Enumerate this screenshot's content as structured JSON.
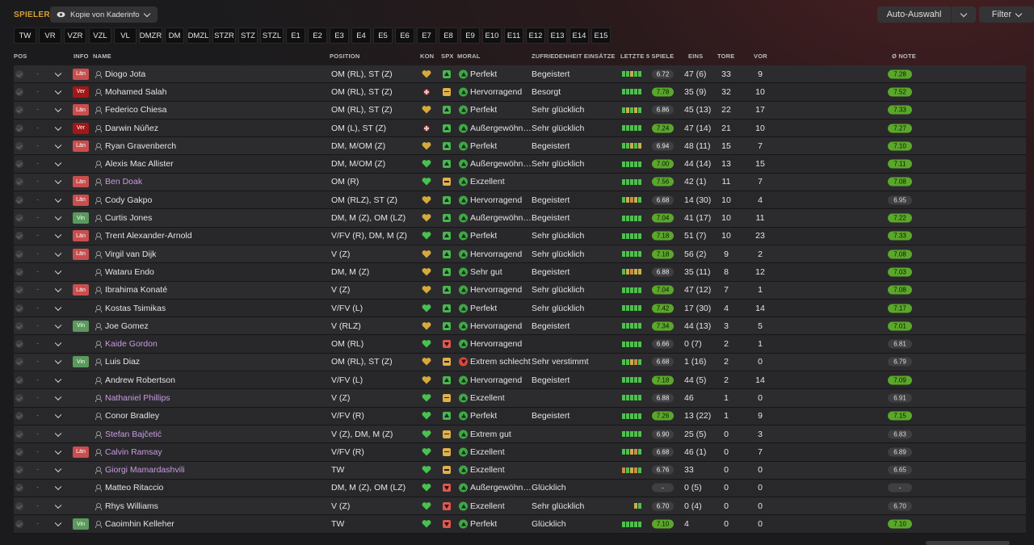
{
  "header": {
    "title": "SPIELER",
    "view": "Kopie von Kaderinfo",
    "auto_label": "Auto-Auswahl",
    "filter_label": "Filter"
  },
  "positions": [
    "TW",
    "VR",
    "VZR",
    "VZL",
    "VL",
    "DMZR",
    "DM",
    "DMZL",
    "STZR",
    "STZ",
    "STZL",
    "E1",
    "E2",
    "E3",
    "E4",
    "E5",
    "E6",
    "E7",
    "E8",
    "E9",
    "E10",
    "E11",
    "E12",
    "E13",
    "E14",
    "E15"
  ],
  "columns": {
    "pos": "POS",
    "info": "INFO",
    "name": "NAME",
    "position": "POSITION",
    "kon": "KON",
    "spx": "SPX",
    "moral": "MORAL",
    "zuf": "ZUFRIEDENHEIT EINSÄTZE",
    "form": "LETZTE 5 SPIELE",
    "eins": "EINS",
    "tore": "TORE",
    "vor": "VOR",
    "note": "Ø NOTE"
  },
  "colors": {
    "accent": "#d8a033",
    "good": "#5aa829",
    "loan": "#c89be0"
  },
  "players": [
    {
      "pos": "-",
      "info": "Län",
      "name": "Diogo Jota",
      "position": "OM (RL), ST (Z)",
      "kon": "gold",
      "spx": "up",
      "moral": "Perfekt",
      "mood": "good",
      "zuf": "Begeistert",
      "form": [
        "g",
        "g",
        "y",
        "g",
        "g"
      ],
      "avg": "6.72",
      "avg_hi": false,
      "eins": "47 (6)",
      "tore": "33",
      "vor": "9",
      "note": "7.28",
      "note_hi": true,
      "loan": false
    },
    {
      "pos": "-",
      "info": "Ver",
      "name": "Mohamed Salah",
      "position": "OM (RL), ST (Z)",
      "kon": "injury",
      "spx": "mid",
      "moral": "Hervorragend",
      "mood": "good",
      "zuf": "Besorgt",
      "form": [
        "g",
        "g",
        "g",
        "g",
        "g"
      ],
      "avg": "7.78",
      "avg_hi": true,
      "eins": "35 (9)",
      "tore": "32",
      "vor": "10",
      "note": "7.52",
      "note_hi": true,
      "loan": false
    },
    {
      "pos": "-",
      "info": "Län",
      "name": "Federico Chiesa",
      "position": "OM (RL), ST (Z)",
      "kon": "gold",
      "spx": "up",
      "moral": "Perfekt",
      "mood": "good",
      "zuf": "Sehr glücklich",
      "form": [
        "g",
        "y",
        "g",
        "y",
        "g"
      ],
      "avg": "6.86",
      "avg_hi": false,
      "eins": "45 (13)",
      "tore": "22",
      "vor": "17",
      "note": "7.33",
      "note_hi": true,
      "loan": false
    },
    {
      "pos": "-",
      "info": "Ver",
      "name": "Darwin Núñez",
      "position": "OM (L), ST (Z)",
      "kon": "injury",
      "spx": "up",
      "moral": "Außergewöhnlich",
      "mood": "good",
      "zuf": "Sehr glücklich",
      "form": [
        "g",
        "g",
        "g",
        "g",
        "g"
      ],
      "avg": "7.24",
      "avg_hi": true,
      "eins": "47 (14)",
      "tore": "21",
      "vor": "10",
      "note": "7.27",
      "note_hi": true,
      "loan": false
    },
    {
      "pos": "-",
      "info": "Län",
      "name": "Ryan Gravenberch",
      "position": "DM, M/OM (Z)",
      "kon": "gold",
      "spx": "up",
      "moral": "Perfekt",
      "mood": "good",
      "zuf": "Begeistert",
      "form": [
        "g",
        "g",
        "y",
        "g",
        "y"
      ],
      "avg": "6.94",
      "avg_hi": false,
      "eins": "48 (11)",
      "tore": "15",
      "vor": "7",
      "note": "7.10",
      "note_hi": true,
      "loan": false
    },
    {
      "pos": "-",
      "info": "",
      "name": "Alexis Mac Allister",
      "position": "DM, M/OM (Z)",
      "kon": "green",
      "spx": "up",
      "moral": "Außergewöhnlich",
      "mood": "good",
      "zuf": "Sehr glücklich",
      "form": [
        "g",
        "g",
        "g",
        "g",
        "g"
      ],
      "avg": "7.00",
      "avg_hi": true,
      "eins": "44 (14)",
      "tore": "13",
      "vor": "15",
      "note": "7.11",
      "note_hi": true,
      "loan": false
    },
    {
      "pos": "-",
      "info": "Län",
      "name": "Ben Doak",
      "position": "OM (R)",
      "kon": "green",
      "spx": "mid",
      "moral": "Exzellent",
      "mood": "good",
      "zuf": "",
      "form": [
        "g",
        "g",
        "g",
        "g",
        "g"
      ],
      "avg": "7.56",
      "avg_hi": true,
      "eins": "42 (1)",
      "tore": "11",
      "vor": "7",
      "note": "7.08",
      "note_hi": true,
      "loan": true
    },
    {
      "pos": "-",
      "info": "Län",
      "name": "Cody Gakpo",
      "position": "OM (RLZ), ST (Z)",
      "kon": "gold",
      "spx": "up",
      "moral": "Hervorragend",
      "mood": "good",
      "zuf": "Begeistert",
      "form": [
        "g",
        "y",
        "o",
        "y",
        "g"
      ],
      "avg": "6.68",
      "avg_hi": false,
      "eins": "14 (30)",
      "tore": "10",
      "vor": "4",
      "note": "6.95",
      "note_hi": false,
      "loan": false
    },
    {
      "pos": "-",
      "info": "Vin",
      "name": "Curtis Jones",
      "position": "DM, M (Z), OM (LZ)",
      "kon": "gold",
      "spx": "up",
      "moral": "Außergewöhnlich",
      "mood": "good",
      "zuf": "Begeistert",
      "form": [
        "g",
        "g",
        "g",
        "g",
        "g"
      ],
      "avg": "7.04",
      "avg_hi": true,
      "eins": "41 (17)",
      "tore": "10",
      "vor": "11",
      "note": "7.22",
      "note_hi": true,
      "loan": false
    },
    {
      "pos": "-",
      "info": "Län",
      "name": "Trent Alexander-Arnold",
      "position": "V/FV (R), DM, M (Z)",
      "kon": "green",
      "spx": "up",
      "moral": "Perfekt",
      "mood": "good",
      "zuf": "Sehr glücklich",
      "form": [
        "g",
        "g",
        "g",
        "g",
        "g"
      ],
      "avg": "7.18",
      "avg_hi": true,
      "eins": "51 (7)",
      "tore": "10",
      "vor": "23",
      "note": "7.33",
      "note_hi": true,
      "loan": false
    },
    {
      "pos": "-",
      "info": "Län",
      "name": "Virgil van Dijk",
      "position": "V (Z)",
      "kon": "gold",
      "spx": "up",
      "moral": "Hervorragend",
      "mood": "good",
      "zuf": "Sehr glücklich",
      "form": [
        "g",
        "g",
        "g",
        "g",
        "g"
      ],
      "avg": "7.18",
      "avg_hi": true,
      "eins": "56 (2)",
      "tore": "9",
      "vor": "2",
      "note": "7.08",
      "note_hi": true,
      "loan": false
    },
    {
      "pos": "-",
      "info": "",
      "name": "Wataru Endo",
      "position": "DM, M (Z)",
      "kon": "gold",
      "spx": "up",
      "moral": "Sehr gut",
      "mood": "good",
      "zuf": "Begeistert",
      "form": [
        "g",
        "y",
        "o",
        "y",
        "y"
      ],
      "avg": "6.88",
      "avg_hi": false,
      "eins": "35 (11)",
      "tore": "8",
      "vor": "12",
      "note": "7.03",
      "note_hi": true,
      "loan": false
    },
    {
      "pos": "-",
      "info": "Län",
      "name": "Ibrahima Konaté",
      "position": "V (Z)",
      "kon": "gold",
      "spx": "up",
      "moral": "Hervorragend",
      "mood": "good",
      "zuf": "Sehr glücklich",
      "form": [
        "g",
        "g",
        "g",
        "g",
        "g"
      ],
      "avg": "7.04",
      "avg_hi": true,
      "eins": "47 (12)",
      "tore": "7",
      "vor": "1",
      "note": "7.08",
      "note_hi": true,
      "loan": false
    },
    {
      "pos": "-",
      "info": "",
      "name": "Kostas Tsimikas",
      "position": "V/FV (L)",
      "kon": "green",
      "spx": "up",
      "moral": "Perfekt",
      "mood": "good",
      "zuf": "Sehr glücklich",
      "form": [
        "g",
        "g",
        "g",
        "g",
        "g"
      ],
      "avg": "7.42",
      "avg_hi": true,
      "eins": "17 (30)",
      "tore": "4",
      "vor": "14",
      "note": "7.17",
      "note_hi": true,
      "loan": false
    },
    {
      "pos": "-",
      "info": "Vin",
      "name": "Joe Gomez",
      "position": "V (RLZ)",
      "kon": "gold",
      "spx": "up",
      "moral": "Hervorragend",
      "mood": "good",
      "zuf": "Begeistert",
      "form": [
        "g",
        "g",
        "g",
        "g",
        "g"
      ],
      "avg": "7.34",
      "avg_hi": true,
      "eins": "44 (13)",
      "tore": "3",
      "vor": "5",
      "note": "7.01",
      "note_hi": true,
      "loan": false
    },
    {
      "pos": "-",
      "info": "",
      "name": "Kaide Gordon",
      "position": "OM (RL)",
      "kon": "green",
      "spx": "down",
      "moral": "Hervorragend",
      "mood": "good",
      "zuf": "",
      "form": [
        "g",
        "g",
        "g",
        "g",
        "g"
      ],
      "avg": "6.66",
      "avg_hi": false,
      "eins": "0 (7)",
      "tore": "2",
      "vor": "1",
      "note": "6.81",
      "note_hi": false,
      "loan": true
    },
    {
      "pos": "-",
      "info": "Vin",
      "name": "Luis Diaz",
      "position": "OM (RL), ST (Z)",
      "kon": "gold",
      "spx": "mid",
      "moral": "Extrem schlecht",
      "mood": "bad",
      "zuf": "Sehr verstimmt",
      "form": [
        "g",
        "g",
        "y",
        "o",
        "g"
      ],
      "avg": "6.68",
      "avg_hi": false,
      "eins": "1 (16)",
      "tore": "2",
      "vor": "0",
      "note": "6.79",
      "note_hi": false,
      "loan": false
    },
    {
      "pos": "-",
      "info": "",
      "name": "Andrew Robertson",
      "position": "V/FV (L)",
      "kon": "gold",
      "spx": "up",
      "moral": "Hervorragend",
      "mood": "good",
      "zuf": "Begeistert",
      "form": [
        "g",
        "g",
        "g",
        "g",
        "g"
      ],
      "avg": "7.18",
      "avg_hi": true,
      "eins": "44 (5)",
      "tore": "2",
      "vor": "14",
      "note": "7.09",
      "note_hi": true,
      "loan": false
    },
    {
      "pos": "-",
      "info": "",
      "name": "Nathaniel Phillips",
      "position": "V (Z)",
      "kon": "green",
      "spx": "mid",
      "moral": "Exzellent",
      "mood": "good",
      "zuf": "",
      "form": [
        "g",
        "g",
        "g",
        "g",
        "g"
      ],
      "avg": "6.88",
      "avg_hi": false,
      "eins": "46",
      "tore": "1",
      "vor": "0",
      "note": "6.91",
      "note_hi": false,
      "loan": true
    },
    {
      "pos": "-",
      "info": "",
      "name": "Conor Bradley",
      "position": "V/FV (R)",
      "kon": "green",
      "spx": "up",
      "moral": "Perfekt",
      "mood": "good",
      "zuf": "Begeistert",
      "form": [
        "g",
        "g",
        "g",
        "g",
        "g"
      ],
      "avg": "7.26",
      "avg_hi": true,
      "eins": "13 (22)",
      "tore": "1",
      "vor": "9",
      "note": "7.15",
      "note_hi": true,
      "loan": false
    },
    {
      "pos": "-",
      "info": "",
      "name": "Stefan Bajčetić",
      "position": "V (Z), DM, M (Z)",
      "kon": "green",
      "spx": "mid",
      "moral": "Extrem gut",
      "mood": "good",
      "zuf": "",
      "form": [
        "g",
        "g",
        "g",
        "g",
        "g"
      ],
      "avg": "6.90",
      "avg_hi": false,
      "eins": "25 (5)",
      "tore": "0",
      "vor": "3",
      "note": "6.83",
      "note_hi": false,
      "loan": true
    },
    {
      "pos": "-",
      "info": "Län",
      "name": "Calvin Ramsay",
      "position": "V/FV (R)",
      "kon": "green",
      "spx": "mid",
      "moral": "Exzellent",
      "mood": "good",
      "zuf": "",
      "form": [
        "g",
        "g",
        "y",
        "o",
        "g"
      ],
      "avg": "6.68",
      "avg_hi": false,
      "eins": "46 (1)",
      "tore": "0",
      "vor": "7",
      "note": "6.89",
      "note_hi": false,
      "loan": true
    },
    {
      "pos": "-",
      "info": "",
      "name": "Giorgi Mamardashvili",
      "position": "TW",
      "kon": "green",
      "spx": "mid",
      "moral": "Exzellent",
      "mood": "good",
      "zuf": "",
      "form": [
        "o",
        "g",
        "y",
        "o",
        "g"
      ],
      "avg": "6.76",
      "avg_hi": false,
      "eins": "33",
      "tore": "0",
      "vor": "0",
      "note": "6.65",
      "note_hi": false,
      "loan": true
    },
    {
      "pos": "-",
      "info": "",
      "name": "Matteo Ritaccio",
      "position": "DM, M (Z), OM (LZ)",
      "kon": "green",
      "spx": "down",
      "moral": "Außergewöhnlich",
      "mood": "good",
      "zuf": "Glücklich",
      "form": [],
      "avg": "-",
      "avg_hi": false,
      "eins": "0 (5)",
      "tore": "0",
      "vor": "0",
      "note": "-",
      "note_hi": false,
      "loan": false
    },
    {
      "pos": "-",
      "info": "",
      "name": "Rhys Williams",
      "position": "V (Z)",
      "kon": "green",
      "spx": "down",
      "moral": "Exzellent",
      "mood": "good",
      "zuf": "Sehr glücklich",
      "form": [
        "y",
        "g"
      ],
      "avg": "6.70",
      "avg_hi": false,
      "eins": "0 (4)",
      "tore": "0",
      "vor": "0",
      "note": "6.70",
      "note_hi": false,
      "loan": false
    },
    {
      "pos": "-",
      "info": "Vin",
      "name": "Caoimhin Kelleher",
      "position": "TW",
      "kon": "green",
      "spx": "down",
      "moral": "Perfekt",
      "mood": "good",
      "zuf": "Glücklich",
      "form": [
        "g",
        "g",
        "g",
        "g",
        "g"
      ],
      "avg": "7.10",
      "avg_hi": true,
      "eins": "4",
      "tore": "0",
      "vor": "0",
      "note": "7.10",
      "note_hi": true,
      "loan": false
    }
  ]
}
